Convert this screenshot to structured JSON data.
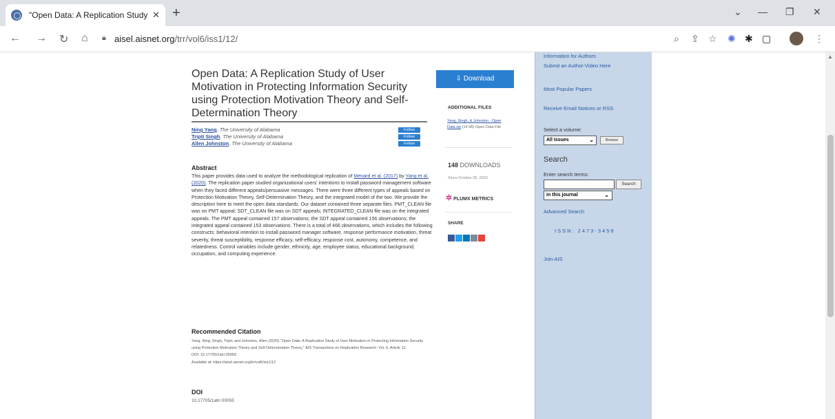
{
  "browser": {
    "tab_title": "\"Open Data: A Replication Study",
    "tab_close": "✕",
    "new_tab": "+",
    "url_domain": "aisel.aisnet.org",
    "url_path": "/trr/vol6/iss1/12/"
  },
  "article": {
    "title": "Open Data: A Replication Study of User Motivation in Protecting Information Security using Protection Motivation Theory and Self-Determination Theory",
    "authors": [
      {
        "name": "Ning Yang",
        "affiliation": ", The University of Alabama",
        "follow": "Follow"
      },
      {
        "name": "Tripti Singh",
        "affiliation": ", The University of Alabama",
        "follow": "Follow"
      },
      {
        "name": "Allen Johnston",
        "affiliation": ", The University of Alabama",
        "follow": "Follow"
      }
    ],
    "abstract_heading": "Abstract",
    "abstract_pre": "This paper provides data used to analyze the methodological replication of ",
    "abstract_link1": "Menard et al. (2017)",
    "abstract_mid": " by ",
    "abstract_link2": "Yang et al. (2020)",
    "abstract_post": ". The replication paper studied organizational users' intentions to install password management software when they faced different appeals/persuasive messages. There were three different types of appeals based on Protection Motivation Theory, Self-Determination Theory, and the integrated model of the two. We provide the description here to meet the open data standards. Our dataset contained three separate files. PMT_CLEAN file was on PMT appeal; SDT_CLEAN file was on SDT appeals; INTEGRATED_CLEAN file was on the integrated appeals. The PMT appeal contained 157 observations; the SDT appeal contained 156 observations; the integrated appeal contained 153 observations. There is a total of 466 observations, which includes the following constructs: behavioral intention to install password manager software, response performance motivation, threat severity, threat susceptibility, response efficacy, self-efficacy, response cost, autonomy, competence, and relatedness. Control variables include gender, ethnicity, age, employee status, educational background, occupation, and computing experience.",
    "citation_heading": "Recommended Citation",
    "citation_text": "Yang, Ning; Singh, Tripti; and Johnston, Allen (2020) \"Open Data: A Replication Study of User Motivation in Protecting Information Security using Protection Motivation Theory and Self-Determination Theory,\" AIS Transactions on Replication Research: Vol. 6, Article 12.",
    "citation_doi": "DOI: 10.17705/1atrr.00055",
    "citation_available": "Available at: https://aisel.aisnet.org/trr/vol6/iss1/12",
    "doi_heading": "DOI",
    "doi_value": "10.17705/1atrr.00055"
  },
  "right_column": {
    "download_label": "⇩ Download",
    "additional_files_heading": "ADDITIONAL FILES",
    "additional_file_link": "Yang, Singh, & Johnston - Open Data.zip",
    "additional_file_desc": " (14 kB) Open Data File",
    "downloads_count": "148",
    "downloads_label": " DOWNLOADS",
    "since": "Since October 06, 2020",
    "plumx_label": "PLUMX METRICS",
    "share_heading": "SHARE"
  },
  "sidebar": {
    "info_authors": "Information for Authors",
    "submit_video": "Submit an Author-Video Here",
    "popular": "Most Popular Papers",
    "email_notices": "Receive Email Notices or RSS",
    "select_volume_label": "Select a volume:",
    "volume_value": "All Issues",
    "browse_label": "Browse",
    "search_heading": "Search",
    "enter_terms_label": "Enter search terms:",
    "search_button": "Search",
    "scope_value": "in this journal",
    "advanced_search": "Advanced Search",
    "issn": "ISSN: 2473-3458",
    "join_ais": "Join AIS"
  },
  "colors": {
    "accent_blue": "#2b7fd1",
    "sidebar_bg": "#c7d6e9",
    "link": "#2a5aa0"
  }
}
